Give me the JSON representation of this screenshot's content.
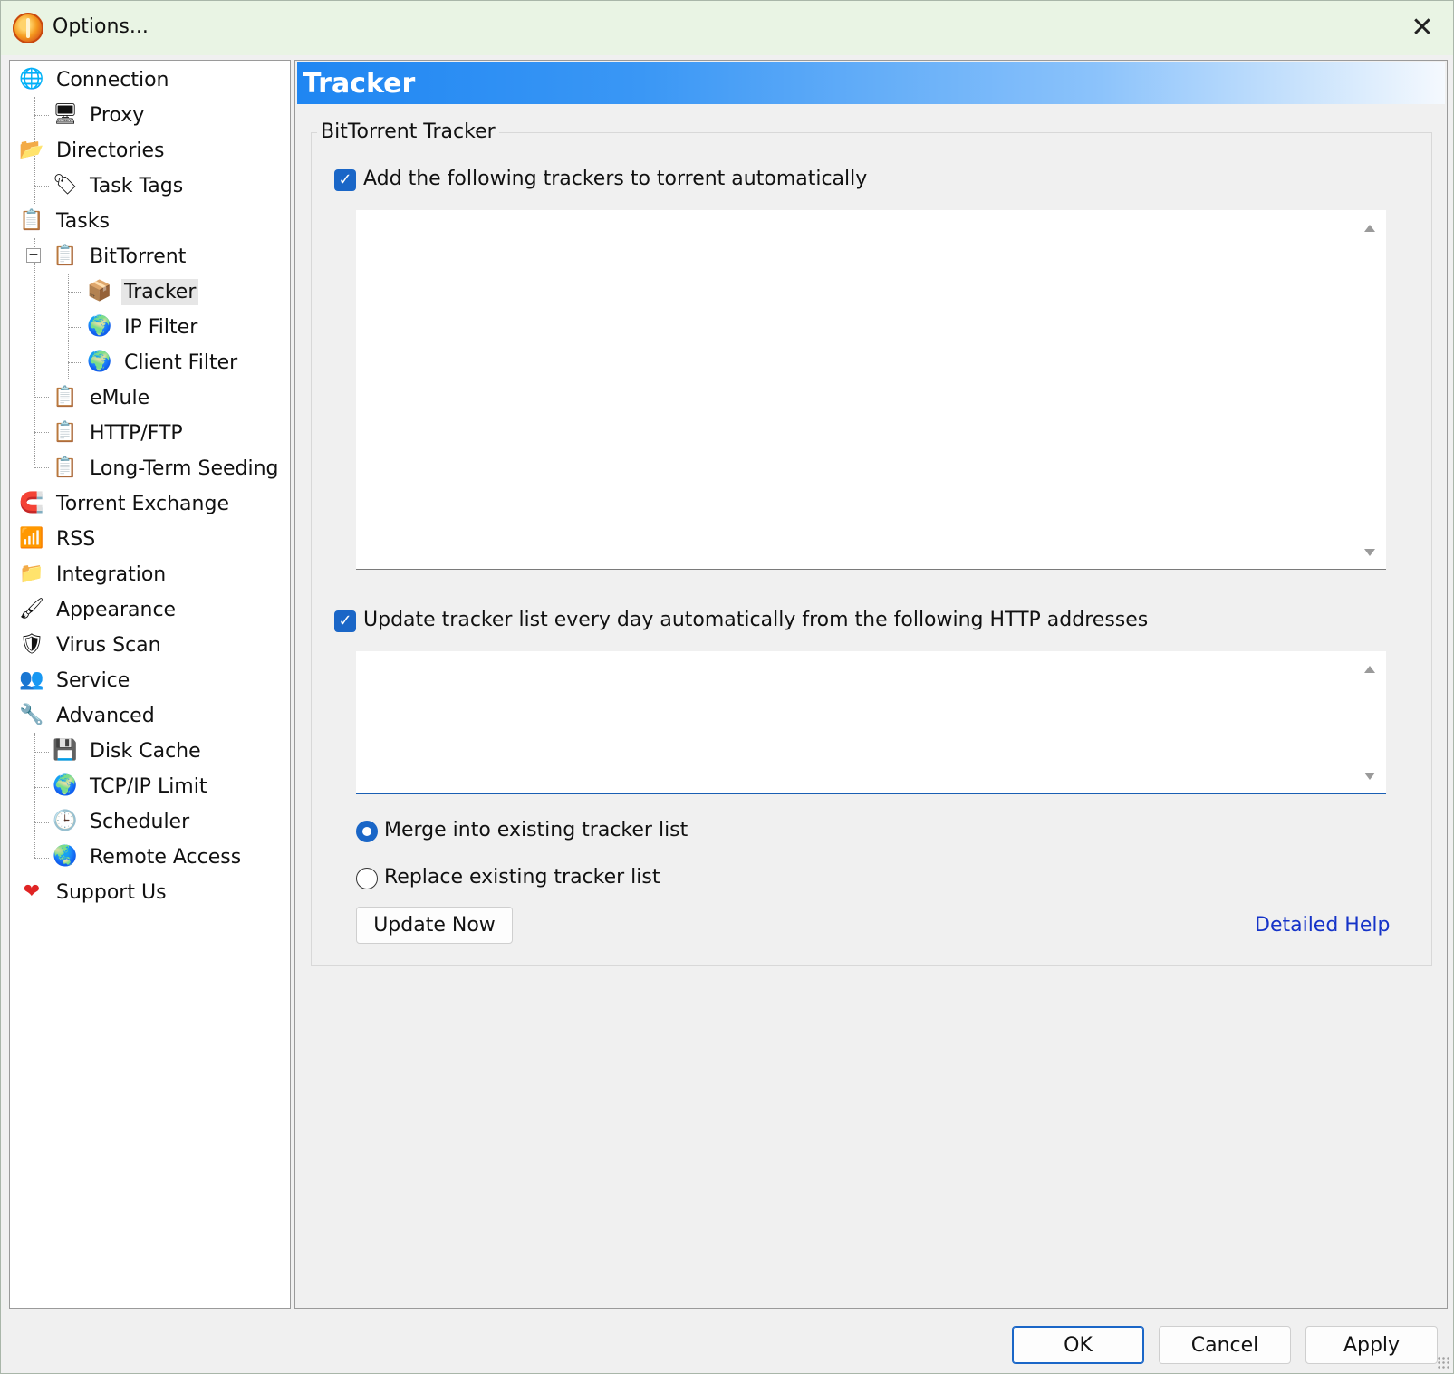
{
  "window": {
    "title": "Options...",
    "close_icon": "close-icon"
  },
  "tree": {
    "items": [
      {
        "label": "Connection",
        "icon": "globe-network-icon"
      },
      {
        "label": "Proxy",
        "icon": "monitor-network-icon"
      },
      {
        "label": "Directories",
        "icon": "folder-open-icon"
      },
      {
        "label": "Task Tags",
        "icon": "tag-icon"
      },
      {
        "label": "Tasks",
        "icon": "clipboard-check-icon"
      },
      {
        "label": "BitTorrent",
        "icon": "clipboard-check-icon"
      },
      {
        "label": "Tracker",
        "icon": "cube-icon"
      },
      {
        "label": "IP Filter",
        "icon": "globe-filter-icon"
      },
      {
        "label": "Client Filter",
        "icon": "globe-filter-icon"
      },
      {
        "label": "eMule",
        "icon": "clipboard-check-icon"
      },
      {
        "label": "HTTP/FTP",
        "icon": "clipboard-check-icon"
      },
      {
        "label": "Long-Term Seeding",
        "icon": "clipboard-check-icon"
      },
      {
        "label": "Torrent Exchange",
        "icon": "magnet-icon"
      },
      {
        "label": "RSS",
        "icon": "rss-icon"
      },
      {
        "label": "Integration",
        "icon": "integration-icon"
      },
      {
        "label": "Appearance",
        "icon": "appearance-icon"
      },
      {
        "label": "Virus Scan",
        "icon": "shield-check-icon"
      },
      {
        "label": "Service",
        "icon": "users-icon"
      },
      {
        "label": "Advanced",
        "icon": "advanced-icon"
      },
      {
        "label": "Disk Cache",
        "icon": "disk-icon"
      },
      {
        "label": "TCP/IP Limit",
        "icon": "globe-icon"
      },
      {
        "label": "Scheduler",
        "icon": "clock-icon"
      },
      {
        "label": "Remote Access",
        "icon": "globe-icon"
      },
      {
        "label": "Support Us",
        "icon": "heart-icon"
      }
    ],
    "selected": "Tracker"
  },
  "panel": {
    "title": "Tracker",
    "group_title": "BitTorrent Tracker",
    "add_trackers": {
      "label": "Add the following trackers to torrent automatically",
      "checked": true,
      "value": ""
    },
    "update_list": {
      "label": "Update tracker list every day automatically from the following HTTP addresses",
      "checked": true,
      "value": ""
    },
    "merge_option": {
      "label": "Merge into existing tracker list",
      "selected": true
    },
    "replace_option": {
      "label": "Replace existing tracker list",
      "selected": false
    },
    "update_now_label": "Update Now",
    "help_link": "Detailed Help"
  },
  "footer": {
    "ok_label": "OK",
    "cancel_label": "Cancel",
    "apply_label": "Apply"
  },
  "colors": {
    "accent": "#1a66c7",
    "header_gradient_start": "#1f86f2",
    "link": "#1533c8",
    "titlebar": "#e9f4e4"
  }
}
